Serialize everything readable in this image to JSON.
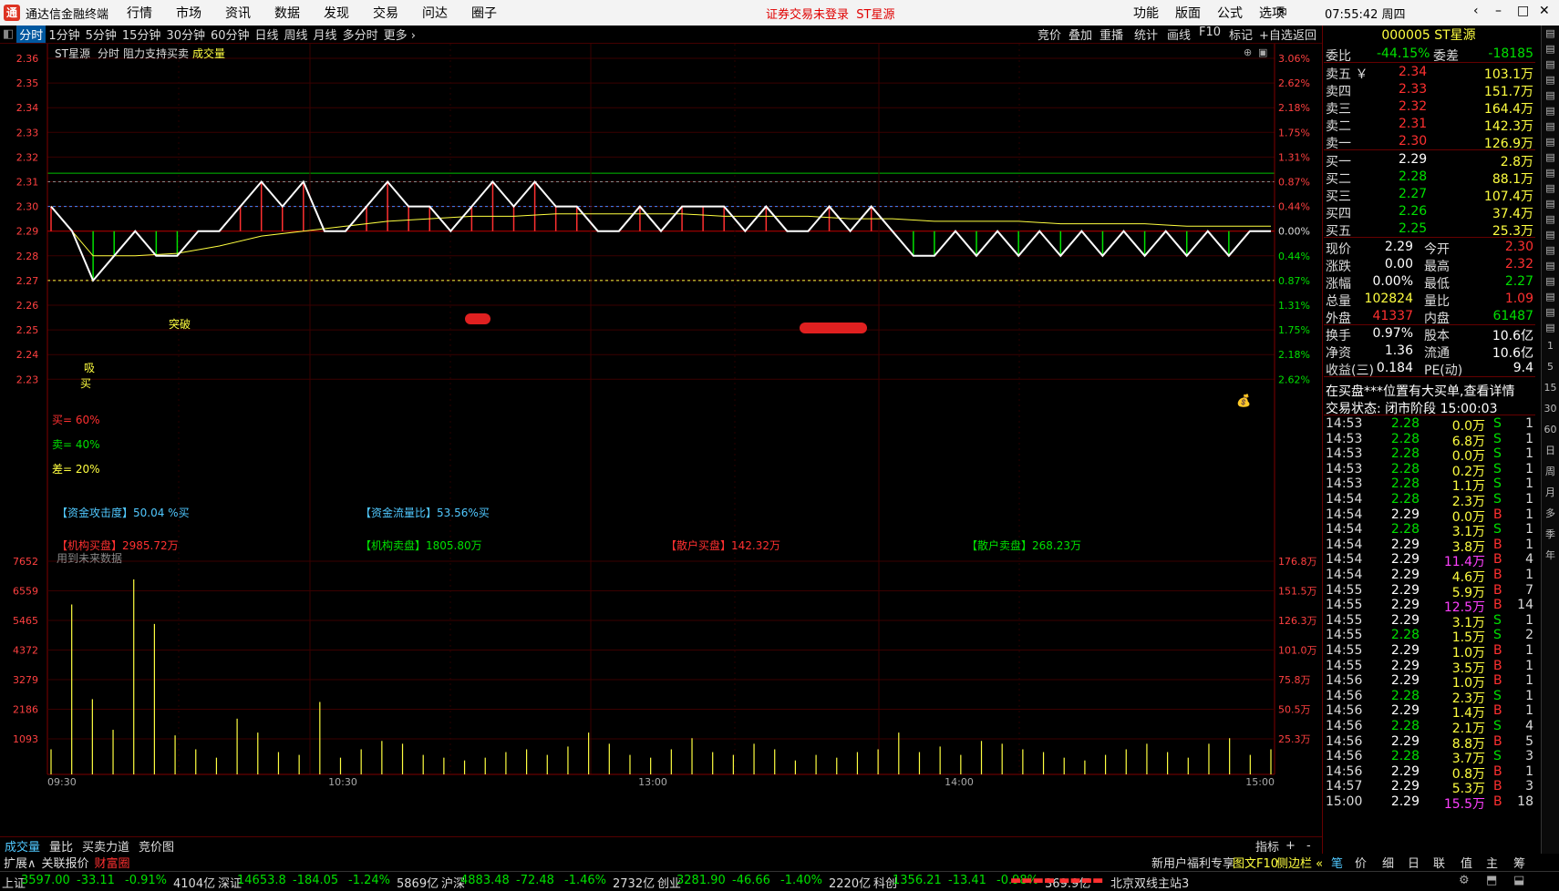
{
  "window": {
    "app_name": "通达信金融终端",
    "menus": [
      "行情",
      "市场",
      "资讯",
      "数据",
      "发现",
      "交易",
      "问达",
      "圈子"
    ],
    "center_notice": "证券交易未登录",
    "center_stock": "ST星源",
    "right_menus": [
      "功能",
      "版面",
      "公式",
      "选项"
    ],
    "clock": "07:55:42 周四"
  },
  "periods": [
    "分时",
    "1分钟",
    "5分钟",
    "15分钟",
    "30分钟",
    "60分钟",
    "日线",
    "周线",
    "月线",
    "多分时",
    "更多"
  ],
  "chart_tools": [
    "竞价",
    "叠加",
    "重播",
    "统计",
    "画线",
    "F10",
    "标记",
    "+自选",
    "返回"
  ],
  "chart": {
    "header": {
      "stock": "ST星源",
      "mode": "分时",
      "indicator": "阻力支持买卖",
      "volume_tag": "成交量"
    },
    "price_ticks": [
      "2.36",
      "2.35",
      "2.34",
      "2.33",
      "2.32",
      "2.31",
      "2.30",
      "2.29",
      "2.28",
      "2.27",
      "2.26",
      "2.25",
      "2.24",
      "2.23"
    ],
    "pct_ticks": [
      "3.06%",
      "2.62%",
      "2.18%",
      "1.75%",
      "1.31%",
      "0.87%",
      "0.44%",
      "0.00%",
      "0.44%",
      "0.87%",
      "1.31%",
      "1.75%",
      "2.18%",
      "2.62%"
    ],
    "vol_ticks_left": [
      "7652",
      "6559",
      "5465",
      "4372",
      "3279",
      "2186",
      "1093"
    ],
    "vol_ticks_right": [
      "176.8万",
      "151.5万",
      "126.3万",
      "101.0万",
      "75.8万",
      "50.5万",
      "25.3万"
    ],
    "time_ticks": [
      "09:30",
      "10:30",
      "13:00",
      "14:00",
      "15:00"
    ],
    "markers": {
      "buy_zone": "买",
      "absorb": "吸",
      "breakout": "突破",
      "buy_pct": "买= 60%",
      "sell_pct": "卖= 40%",
      "diff_pct": "差= 20%"
    },
    "flow": {
      "attack": "【资金攻击度】50.04 %买",
      "flow_ratio": "【资金流量比】53.56%买",
      "inst_buy": "【机构买盘】2985.72万",
      "inst_sell": "【机构卖盘】1805.80万",
      "retail_buy": "【散户买盘】142.32万",
      "retail_sell": "【散户卖盘】268.23万",
      "future_note": "用到未来数据"
    }
  },
  "chart_data": {
    "type": "line",
    "title": "ST星源 分时",
    "price_range": [
      2.23,
      2.36
    ],
    "prev_close": 2.29,
    "price_series": [
      2.3,
      2.29,
      2.27,
      2.28,
      2.29,
      2.28,
      2.28,
      2.29,
      2.29,
      2.3,
      2.31,
      2.3,
      2.31,
      2.29,
      2.29,
      2.3,
      2.31,
      2.3,
      2.3,
      2.29,
      2.3,
      2.31,
      2.3,
      2.31,
      2.3,
      2.3,
      2.29,
      2.29,
      2.3,
      2.29,
      2.3,
      2.3,
      2.3,
      2.29,
      2.3,
      2.29,
      2.29,
      2.3,
      2.29,
      2.3,
      2.29,
      2.28,
      2.28,
      2.29,
      2.28,
      2.29,
      2.28,
      2.29,
      2.28,
      2.29,
      2.28,
      2.29,
      2.28,
      2.29,
      2.28,
      2.29,
      2.28,
      2.29,
      2.29
    ],
    "avg_series": [
      2.3,
      2.28,
      2.28,
      2.281,
      2.284,
      2.288,
      2.29,
      2.292,
      2.294,
      2.295,
      2.296,
      2.296,
      2.297,
      2.297,
      2.297,
      2.297,
      2.296,
      2.296,
      2.296,
      2.295,
      2.295,
      2.294,
      2.294,
      2.294,
      2.293,
      2.293,
      2.293,
      2.292,
      2.292,
      2.292
    ],
    "volume_range": [
      0,
      7652
    ],
    "volumes": [
      900,
      6100,
      2700,
      1600,
      7000,
      5400,
      1400,
      900,
      600,
      2000,
      1500,
      800,
      700,
      2600,
      600,
      900,
      1200,
      1100,
      700,
      600,
      500,
      600,
      800,
      900,
      700,
      1000,
      1500,
      1100,
      700,
      600,
      900,
      1300,
      800,
      700,
      1100,
      900,
      500,
      700,
      600,
      800,
      900,
      1500,
      800,
      1000,
      700,
      1200,
      1100,
      900,
      800,
      600,
      500,
      700,
      900,
      1100,
      800,
      600,
      1100,
      1300,
      700,
      900
    ]
  },
  "quote": {
    "code_name": "000005 ST星源",
    "weibi_label": "委比",
    "weibi": "-44.15%",
    "weicha_label": "委差",
    "weicha": "-18185",
    "asks": [
      {
        "label": "卖五",
        "mark": "￥",
        "price": "2.34",
        "vol": "103.1万"
      },
      {
        "label": "卖四",
        "mark": "",
        "price": "2.33",
        "vol": "151.7万"
      },
      {
        "label": "卖三",
        "mark": "",
        "price": "2.32",
        "vol": "164.4万"
      },
      {
        "label": "卖二",
        "mark": "",
        "price": "2.31",
        "vol": "142.3万"
      },
      {
        "label": "卖一",
        "mark": "",
        "price": "2.30",
        "vol": "126.9万"
      }
    ],
    "bids": [
      {
        "label": "买一",
        "price": "2.29",
        "vol": "2.8万"
      },
      {
        "label": "买二",
        "price": "2.28",
        "vol": "88.1万"
      },
      {
        "label": "买三",
        "price": "2.27",
        "vol": "107.4万"
      },
      {
        "label": "买四",
        "price": "2.26",
        "vol": "37.4万"
      },
      {
        "label": "买五",
        "price": "2.25",
        "vol": "25.3万"
      }
    ],
    "stats": [
      {
        "l1": "现价",
        "v1": "2.29",
        "l2": "今开",
        "v2": "2.30"
      },
      {
        "l1": "涨跌",
        "v1": "0.00",
        "l2": "最高",
        "v2": "2.32"
      },
      {
        "l1": "涨幅",
        "v1": "0.00%",
        "l2": "最低",
        "v2": "2.27"
      },
      {
        "l1": "总量",
        "v1": "102824",
        "l2": "量比",
        "v2": "1.09"
      },
      {
        "l1": "外盘",
        "v1": "41337",
        "l2": "内盘",
        "v2": "61487"
      },
      {
        "l1": "换手",
        "v1": "0.97%",
        "l2": "股本",
        "v2": "10.6亿"
      },
      {
        "l1": "净资",
        "v1": "1.36",
        "l2": "流通",
        "v2": "10.6亿"
      },
      {
        "l1": "收益(三)",
        "v1": "0.184",
        "l2": "PE(动)",
        "v2": "9.4"
      }
    ],
    "notice": "在买盘***位置有大买单,查看详情",
    "trade_state": "交易状态: 闭市阶段 15:00:03",
    "ticks": [
      {
        "t": "14:53",
        "p": "2.28",
        "v": "0.0万",
        "d": "S",
        "n": "1"
      },
      {
        "t": "14:53",
        "p": "2.28",
        "v": "6.8万",
        "d": "S",
        "n": "1"
      },
      {
        "t": "14:53",
        "p": "2.28",
        "v": "0.0万",
        "d": "S",
        "n": "1"
      },
      {
        "t": "14:53",
        "p": "2.28",
        "v": "0.2万",
        "d": "S",
        "n": "1"
      },
      {
        "t": "14:53",
        "p": "2.28",
        "v": "1.1万",
        "d": "S",
        "n": "1"
      },
      {
        "t": "14:54",
        "p": "2.28",
        "v": "2.3万",
        "d": "S",
        "n": "1"
      },
      {
        "t": "14:54",
        "p": "2.29",
        "v": "0.0万",
        "d": "B",
        "n": "1"
      },
      {
        "t": "14:54",
        "p": "2.28",
        "v": "3.1万",
        "d": "S",
        "n": "1"
      },
      {
        "t": "14:54",
        "p": "2.29",
        "v": "3.8万",
        "d": "B",
        "n": "1"
      },
      {
        "t": "14:54",
        "p": "2.29",
        "v": "11.4万",
        "d": "B",
        "n": "4"
      },
      {
        "t": "14:54",
        "p": "2.29",
        "v": "4.6万",
        "d": "B",
        "n": "1"
      },
      {
        "t": "14:55",
        "p": "2.29",
        "v": "5.9万",
        "d": "B",
        "n": "7"
      },
      {
        "t": "14:55",
        "p": "2.29",
        "v": "12.5万",
        "d": "B",
        "n": "14"
      },
      {
        "t": "14:55",
        "p": "2.29",
        "v": "3.1万",
        "d": "S",
        "n": "1"
      },
      {
        "t": "14:55",
        "p": "2.28",
        "v": "1.5万",
        "d": "S",
        "n": "2"
      },
      {
        "t": "14:55",
        "p": "2.29",
        "v": "1.0万",
        "d": "B",
        "n": "1"
      },
      {
        "t": "14:55",
        "p": "2.29",
        "v": "3.5万",
        "d": "B",
        "n": "1"
      },
      {
        "t": "14:56",
        "p": "2.29",
        "v": "1.0万",
        "d": "B",
        "n": "1"
      },
      {
        "t": "14:56",
        "p": "2.28",
        "v": "2.3万",
        "d": "S",
        "n": "1"
      },
      {
        "t": "14:56",
        "p": "2.29",
        "v": "1.4万",
        "d": "B",
        "n": "1"
      },
      {
        "t": "14:56",
        "p": "2.28",
        "v": "2.1万",
        "d": "S",
        "n": "4"
      },
      {
        "t": "14:56",
        "p": "2.29",
        "v": "8.8万",
        "d": "B",
        "n": "5"
      },
      {
        "t": "14:56",
        "p": "2.28",
        "v": "3.7万",
        "d": "S",
        "n": "3"
      },
      {
        "t": "14:56",
        "p": "2.29",
        "v": "0.8万",
        "d": "B",
        "n": "1"
      },
      {
        "t": "14:57",
        "p": "2.29",
        "v": "5.3万",
        "d": "B",
        "n": "3"
      },
      {
        "t": "15:00",
        "p": "2.29",
        "v": "15.5万",
        "d": "B",
        "n": "18"
      }
    ],
    "bottom_tabs": [
      "笔",
      "价",
      "细",
      "日",
      "联",
      "值",
      "主",
      "筹"
    ]
  },
  "side_labels": [
    "1",
    "5",
    "15",
    "30",
    "60",
    "日",
    "周",
    "月",
    "多",
    "季",
    "年"
  ],
  "bottom_tabs": [
    "成交量",
    "量比",
    "买卖力道",
    "竞价图"
  ],
  "bottom_right": {
    "indicator": "指标",
    "plus": "+",
    "minus": "-"
  },
  "status": {
    "expand": "扩展∧",
    "linked": "关联报价",
    "fortune": "财富圈",
    "ad": "新用户福利专享",
    "f10": "图文F10",
    "sidebar": "侧边栏 «"
  },
  "indices": [
    {
      "name": "上证",
      "val": "3597.00",
      "chg": "-33.11",
      "pct": "-0.91%",
      "amt": "4104亿"
    },
    {
      "name": "深证",
      "val": "14653.8",
      "chg": "-184.05",
      "pct": "-1.24%",
      "amt": "5869亿"
    },
    {
      "name": "沪深",
      "val": "4883.48",
      "chg": "-72.48",
      "pct": "-1.46%",
      "amt": "2732亿"
    },
    {
      "name": "创业",
      "val": "3281.90",
      "chg": "-46.66",
      "pct": "-1.40%",
      "amt": "2220亿"
    },
    {
      "name": "科创",
      "val": "1356.21",
      "chg": "-13.41",
      "pct": "-0.98%",
      "amt": "369.9亿"
    }
  ],
  "server": "北京双线主站3",
  "colors": {
    "up": "#ff3030",
    "down": "#00e000",
    "price_line": "#ffffff",
    "avg_line": "#ffff40",
    "grid": "#5a0000",
    "background": "#000000"
  }
}
